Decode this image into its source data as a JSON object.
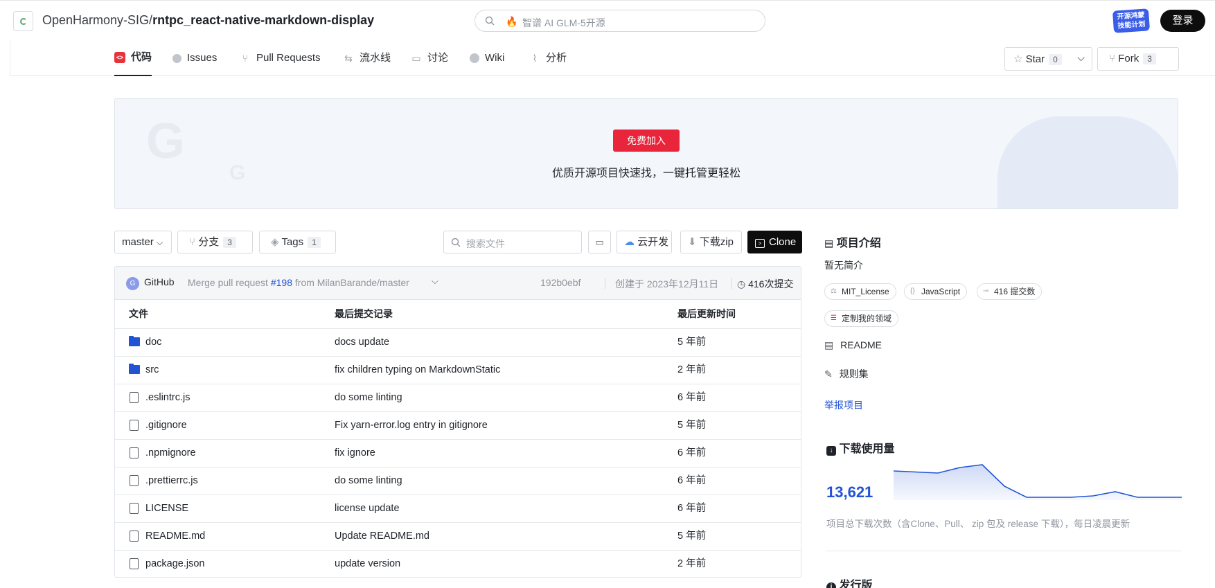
{
  "header": {
    "owner": "OpenHarmony-SIG/",
    "repo": "rntpc_react-native-markdown-display",
    "search_placeholder": "智谱 AI GLM-5开源",
    "badge_text": "开源鸿蒙 技能计划",
    "login_label": "登录"
  },
  "tabs": [
    {
      "label": "代码",
      "icon": "code-icon"
    },
    {
      "label": "Issues",
      "icon": "issues-icon"
    },
    {
      "label": "Pull Requests",
      "icon": "pull-request-icon"
    },
    {
      "label": "流水线",
      "icon": "pipeline-icon"
    },
    {
      "label": "讨论",
      "icon": "discussion-icon"
    },
    {
      "label": "Wiki",
      "icon": "wiki-icon"
    },
    {
      "label": "分析",
      "icon": "analytics-icon"
    }
  ],
  "star": {
    "label": "Star",
    "count": "0"
  },
  "fork": {
    "label": "Fork",
    "count": "3"
  },
  "banner": {
    "button_label": "免费加入",
    "text": "优质开源项目快速找，一键托管更轻松"
  },
  "toolbar": {
    "branch": "master",
    "branches_label": "分支",
    "branches_count": "3",
    "tags_label": "Tags",
    "tags_count": "1",
    "search_placeholder": "搜索文件",
    "cloud_label": "云开发",
    "download_label": "下载zip",
    "clone_label": "Clone"
  },
  "commit": {
    "author": "GitHub",
    "message_prefix": "Merge pull request",
    "pr_link": "#198",
    "message_suffix": "from MilanBarande/master",
    "hash": "192b0ebf",
    "created": "创建于 2023年12月11日",
    "commits": "416次提交"
  },
  "table": {
    "headers": {
      "file": "文件",
      "commit": "最后提交记录",
      "time": "最后更新时间"
    },
    "rows": [
      {
        "name": "doc",
        "type": "folder",
        "message": "docs update",
        "time": "5 年前"
      },
      {
        "name": "src",
        "type": "folder",
        "message": "fix children typing on MarkdownStatic",
        "time": "2 年前"
      },
      {
        "name": ".eslintrc.js",
        "type": "file",
        "message": "do some linting",
        "time": "6 年前"
      },
      {
        "name": ".gitignore",
        "type": "file",
        "message": "Fix yarn-error.log entry in gitignore",
        "time": "5 年前"
      },
      {
        "name": ".npmignore",
        "type": "file",
        "message": "fix ignore",
        "time": "6 年前"
      },
      {
        "name": ".prettierrc.js",
        "type": "file",
        "message": "do some linting",
        "time": "6 年前"
      },
      {
        "name": "LICENSE",
        "type": "file",
        "message": "license update",
        "time": "6 年前"
      },
      {
        "name": "README.md",
        "type": "file",
        "message": "Update README.md",
        "time": "5 年前"
      },
      {
        "name": "package.json",
        "type": "file",
        "message": "update version",
        "time": "2 年前"
      }
    ]
  },
  "sidebar": {
    "intro_title": "项目介绍",
    "intro_text": "暂无简介",
    "chips": [
      "MIT_License",
      "JavaScript",
      "416 提交数"
    ],
    "domain_chip": "定制我的领域",
    "readme": "README",
    "rules": "规则集",
    "report": "举报项目",
    "downloads_title": "下载使用量",
    "downloads_count": "13,621",
    "downloads_note": "项目总下载次数（含Clone、Pull、 zip 包及 release 下载），每日凌晨更新",
    "releases_title": "发行版",
    "sparkline_color": "#2253d4"
  }
}
